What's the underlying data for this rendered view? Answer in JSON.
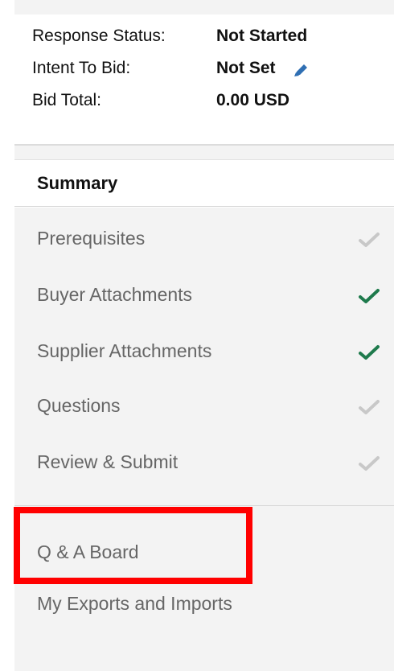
{
  "response_info": {
    "response_status": {
      "label": "Response Status:",
      "value": "Not Started"
    },
    "intent_to_bid": {
      "label": "Intent To Bid:",
      "value": "Not Set",
      "edit_icon": "pencil-icon"
    },
    "bid_total": {
      "label": "Bid Total:",
      "value": "0.00 USD"
    }
  },
  "summary": {
    "label": "Summary"
  },
  "nav": {
    "items": [
      {
        "label": "Prerequisites",
        "status": "incomplete",
        "icon": "check-icon"
      },
      {
        "label": "Buyer Attachments",
        "status": "complete",
        "icon": "check-icon"
      },
      {
        "label": "Supplier Attachments",
        "status": "complete",
        "icon": "check-icon"
      },
      {
        "label": "Questions",
        "status": "incomplete",
        "icon": "check-icon"
      },
      {
        "label": "Review & Submit",
        "status": "incomplete",
        "icon": "check-icon"
      }
    ],
    "extra_items": [
      {
        "label": "Q & A Board",
        "highlighted": true
      },
      {
        "label": "My Exports and Imports"
      }
    ]
  },
  "colors": {
    "check_complete": "#1e7a4c",
    "check_incomplete": "#c8c8c8",
    "pencil": "#2f6fb3",
    "highlight": "#ff0000",
    "nav_background": "#f3f3f3",
    "nav_text": "#666666"
  }
}
